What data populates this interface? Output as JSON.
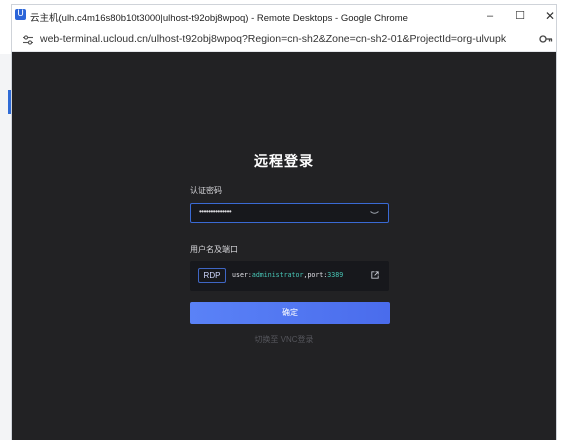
{
  "window": {
    "app_icon": "U",
    "title": "云主机(ulh.c4m16s80b10t3000|ulhost-t92obj8wpoq) - Remote Desktops - Google Chrome",
    "minimize_glyph": "–",
    "maximize_glyph": "☐",
    "close_glyph": "✕"
  },
  "address_bar": {
    "url": "web-terminal.ucloud.cn/ulhost-t92obj8wpoq?Region=cn-sh2&Zone=cn-sh2-01&ProjectId=org-ulvupk",
    "icons": [
      "tune-icon",
      "key-icon"
    ]
  },
  "login": {
    "title": "远程登录",
    "password_label": "认证密码",
    "password_value": "••••••••••••••",
    "user_port_label": "用户名及端口",
    "protocol_tag": "RDP",
    "conn_user_key": "user:",
    "conn_user_value": "administrator",
    "conn_port_key": ",port:",
    "conn_port_value": "3389",
    "confirm_label": "确定",
    "switch_link": "切换至 VNC登录"
  },
  "colors": {
    "background": "#222224",
    "field_bg": "#17181c",
    "accent": "#4f76f1",
    "value_teal": "#48c7b7"
  }
}
